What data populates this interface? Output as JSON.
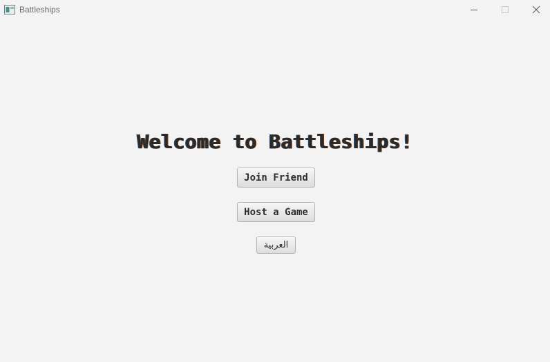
{
  "window": {
    "title": "Battleships",
    "app_icon": "app-window-icon",
    "controls": {
      "minimize_icon": "minimize-icon",
      "maximize_icon": "maximize-icon",
      "close_icon": "close-icon"
    }
  },
  "main": {
    "heading": "Welcome to Battleships!",
    "join_label": "Join Friend",
    "host_label": "Host a Game",
    "language_label": "العربية"
  },
  "colors": {
    "background": "#f3f3f3",
    "heading_text": "#2d2a26",
    "button_border": "#b3b3b3"
  }
}
